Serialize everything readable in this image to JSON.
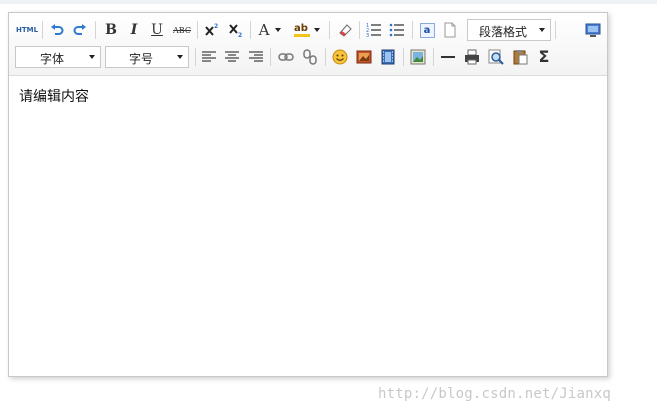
{
  "toolbar": {
    "html_label": "HTML",
    "bold_label": "B",
    "italic_label": "I",
    "underline_label": "U",
    "strike_label": "ABC",
    "font_color_label": "A",
    "highlight_label": "ab",
    "anchor_label": "a",
    "paragraph_dropdown": "段落格式",
    "font_family_dropdown": "字体",
    "font_size_dropdown": "字号",
    "sigma_label": "Σ"
  },
  "editor": {
    "content": "请编辑内容"
  },
  "watermark": "http://blog.csdn.net/Jianxq"
}
